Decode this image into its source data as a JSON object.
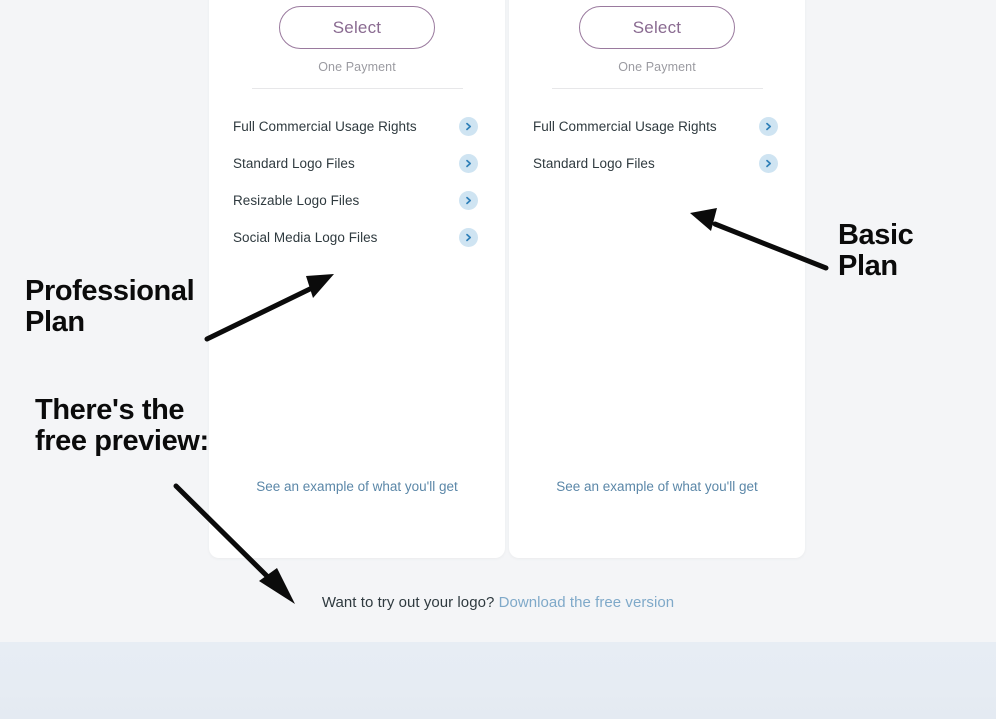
{
  "page": {
    "background_color": "#f4f5f7",
    "footer_band_color": "#e6ecf3"
  },
  "plans": [
    {
      "id": "professional",
      "select_label": "Select",
      "payment_note": "One Payment",
      "features": [
        {
          "label": "Full Commercial Usage Rights",
          "chevron": "chevron-right-icon"
        },
        {
          "label": "Standard Logo Files",
          "chevron": "chevron-right-icon"
        },
        {
          "label": "Resizable Logo Files",
          "chevron": "chevron-right-icon"
        },
        {
          "label": "Social Media Logo Files",
          "chevron": "chevron-right-icon"
        }
      ],
      "example_link": "See an example of what you'll get"
    },
    {
      "id": "basic",
      "select_label": "Select",
      "payment_note": "One Payment",
      "features": [
        {
          "label": "Full Commercial Usage Rights",
          "chevron": "chevron-right-icon"
        },
        {
          "label": "Standard Logo Files",
          "chevron": "chevron-right-icon"
        }
      ],
      "example_link": "See an example of what you'll get"
    }
  ],
  "footer": {
    "tryout_text": "Want to try out your logo?",
    "tryout_link": "Download the free version"
  },
  "annotations": [
    {
      "id": "professional-plan",
      "text": "Professional\nPlan",
      "color": "#0b0b0b"
    },
    {
      "id": "basic-plan",
      "text": "Basic\nPlan",
      "color": "#0b0b0b"
    },
    {
      "id": "free-preview",
      "text": "There's the\nfree preview:",
      "color": "#0b0b0b"
    }
  ],
  "colors": {
    "select_button_border": "#9a7a9e",
    "select_button_text": "#8a6b91",
    "chevron_circle": "#cfe4f2",
    "chevron_glyph": "#2f7fb8",
    "feature_text": "#2f3a3f",
    "example_link": "#5b87a8",
    "tryout_link": "#7fa9c9",
    "payment_note": "#9b9ba1"
  }
}
